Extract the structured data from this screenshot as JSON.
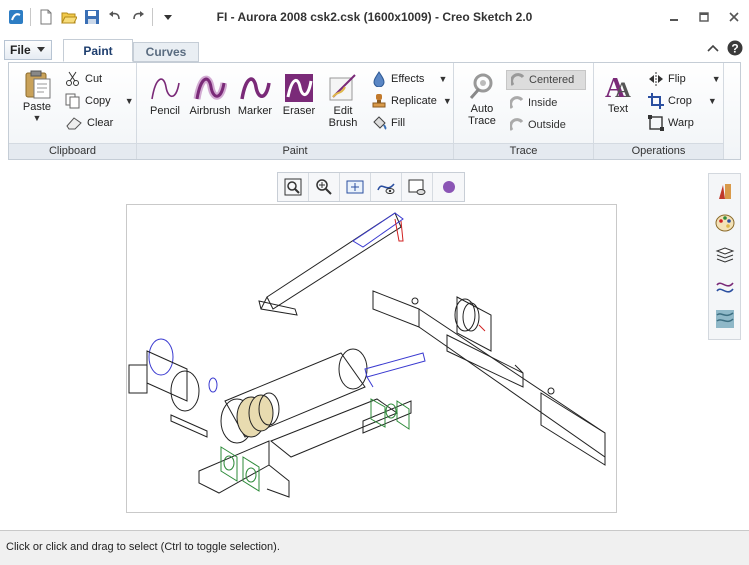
{
  "window": {
    "title": "FI - Aurora 2008 csk2.csk (1600x1009) - Creo Sketch 2.0",
    "quick_access_icons": [
      "app-icon",
      "new-icon",
      "open-icon",
      "save-icon",
      "undo-icon",
      "redo-icon",
      "customize-icon"
    ],
    "controls": [
      "minimize-icon",
      "maximize-icon",
      "close-icon"
    ]
  },
  "menu": {
    "file_label": "File"
  },
  "tabs": [
    {
      "label": "Paint",
      "active": true
    },
    {
      "label": "Curves",
      "active": false
    }
  ],
  "ribbon": {
    "clipboard": {
      "label": "Clipboard",
      "paste": "Paste",
      "cut": "Cut",
      "copy": "Copy",
      "clear": "Clear"
    },
    "paint": {
      "label": "Paint",
      "pencil": "Pencil",
      "airbrush": "Airbrush",
      "marker": "Marker",
      "eraser": "Eraser",
      "edit_brush_1": "Edit",
      "edit_brush_2": "Brush",
      "effects": "Effects",
      "replicate": "Replicate",
      "fill": "Fill"
    },
    "trace": {
      "label": "Trace",
      "auto_trace_1": "Auto",
      "auto_trace_2": "Trace",
      "centered": "Centered",
      "inside": "Inside",
      "outside": "Outside"
    },
    "operations": {
      "label": "Operations",
      "text": "Text",
      "flip": "Flip",
      "crop": "Crop",
      "warp": "Warp"
    }
  },
  "view_toolbar": [
    "zoom-fit-icon",
    "zoom-in-icon",
    "pan-view-icon",
    "curve-visibility-icon",
    "background-icon",
    "color-dot-icon"
  ],
  "sidebar": [
    "brushes-icon",
    "palette-icon",
    "layers-icon",
    "curves-panel-icon",
    "textures-icon"
  ],
  "status": {
    "text": "Click or click and drag to select (Ctrl to toggle selection)."
  },
  "colors": {
    "accent_purple": "#7a2a78",
    "ribbon_border": "#c5cdd6",
    "selection_bg": "#dcdcdc",
    "sketch_blue": "#3a3ad0",
    "sketch_green": "#2e8b3a",
    "sketch_red": "#d02020",
    "sketch_tan": "#e8dbb0"
  }
}
